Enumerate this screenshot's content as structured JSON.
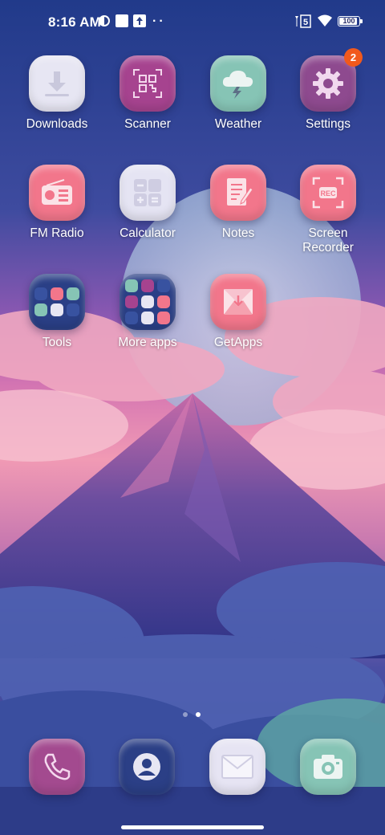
{
  "status_bar": {
    "time": "8:16 AM",
    "battery": "100",
    "signal_label": "5",
    "icons": [
      "vpn-icon",
      "notification-square-icon",
      "upload-icon",
      "more-dots-icon",
      "signal-icon",
      "wifi-icon",
      "battery-icon"
    ]
  },
  "apps": [
    {
      "label": "Downloads",
      "icon": "download-icon",
      "color": "#e7e6f3"
    },
    {
      "label": "Scanner",
      "icon": "qr-scan-icon",
      "color": "#a6438f"
    },
    {
      "label": "Weather",
      "icon": "cloud-lightning-icon",
      "color": "#86c4b5"
    },
    {
      "label": "Settings",
      "icon": "gear-icon",
      "color": "#8e4a8f",
      "badge": "2"
    },
    {
      "label": "FM Radio",
      "icon": "radio-icon",
      "color": "#f2768b"
    },
    {
      "label": "Calculator",
      "icon": "calculator-icon",
      "color": "#e5e4f3"
    },
    {
      "label": "Notes",
      "icon": "notes-icon",
      "color": "#f2768b"
    },
    {
      "label": "Screen Recorder",
      "label_line1": "Screen",
      "label_line2": "Recorder",
      "icon": "screen-record-icon",
      "color": "#f2768b"
    },
    {
      "label": "Tools",
      "icon": "folder-icon",
      "color": "#2a3f86"
    },
    {
      "label": "More apps",
      "icon": "folder-icon",
      "color": "#2a3f86"
    },
    {
      "label": "GetApps",
      "icon": "getapps-icon",
      "color": "#f2768b"
    }
  ],
  "page_indicator": {
    "pages": 2,
    "current": 2
  },
  "dock": [
    {
      "name": "phone",
      "icon": "phone-icon",
      "color": "#a34a8f"
    },
    {
      "name": "contacts",
      "icon": "contact-icon",
      "color": "#2b3f86"
    },
    {
      "name": "messages",
      "icon": "mail-icon",
      "color": "#e6e4f3"
    },
    {
      "name": "camera",
      "icon": "camera-icon",
      "color": "#86c4b5"
    }
  ]
}
